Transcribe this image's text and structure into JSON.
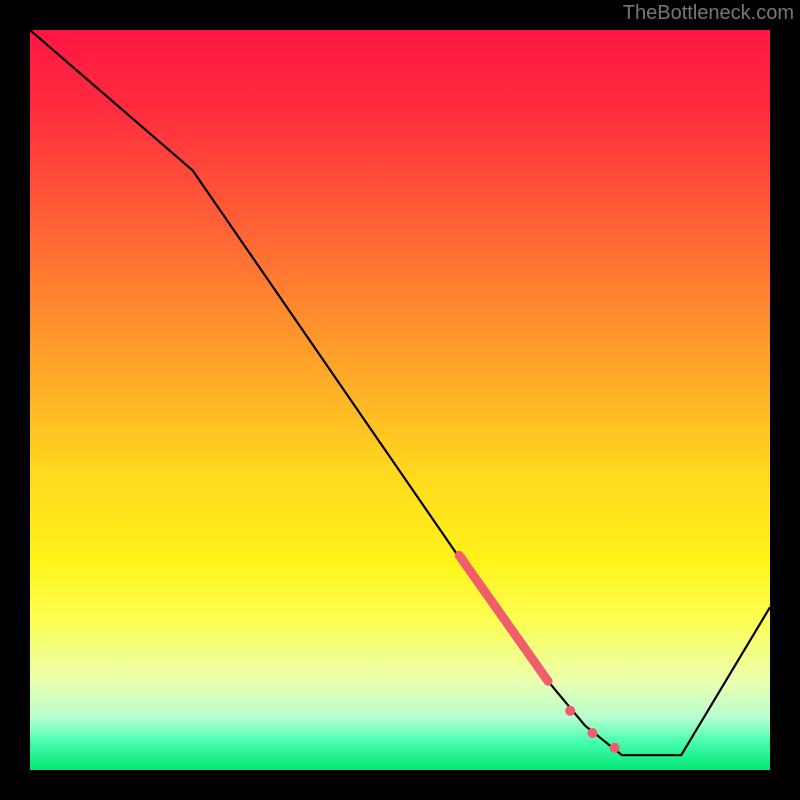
{
  "watermark": "TheBottleneck.com",
  "chart_data": {
    "type": "line",
    "title": "",
    "xlabel": "",
    "ylabel": "",
    "xlim": [
      0,
      100
    ],
    "ylim": [
      0,
      100
    ],
    "grid": false,
    "gradient_stops": [
      {
        "pos": 0,
        "color": "#ff1744"
      },
      {
        "pos": 25,
        "color": "#ff5c36"
      },
      {
        "pos": 60,
        "color": "#ffd91f"
      },
      {
        "pos": 80,
        "color": "#fdff55"
      },
      {
        "pos": 95,
        "color": "#4cffb0"
      },
      {
        "pos": 100,
        "color": "#00e676"
      }
    ],
    "series": [
      {
        "name": "bottleneck-curve",
        "color": "#000000",
        "x": [
          0,
          22,
          64,
          70,
          75,
          80,
          88,
          100
        ],
        "y": [
          100,
          81,
          20,
          12,
          6,
          2,
          2,
          22
        ]
      }
    ],
    "highlight_segment": {
      "name": "selected-range",
      "color": "#ef5e6a",
      "width": 9,
      "x": [
        58,
        70
      ],
      "y": [
        29,
        12
      ]
    },
    "highlight_points": [
      {
        "x": 73,
        "y": 8,
        "r": 5,
        "color": "#ef5e6a"
      },
      {
        "x": 76,
        "y": 5,
        "r": 5,
        "color": "#ef5e6a"
      },
      {
        "x": 79,
        "y": 3,
        "r": 5,
        "color": "#ef5e6a"
      }
    ]
  }
}
